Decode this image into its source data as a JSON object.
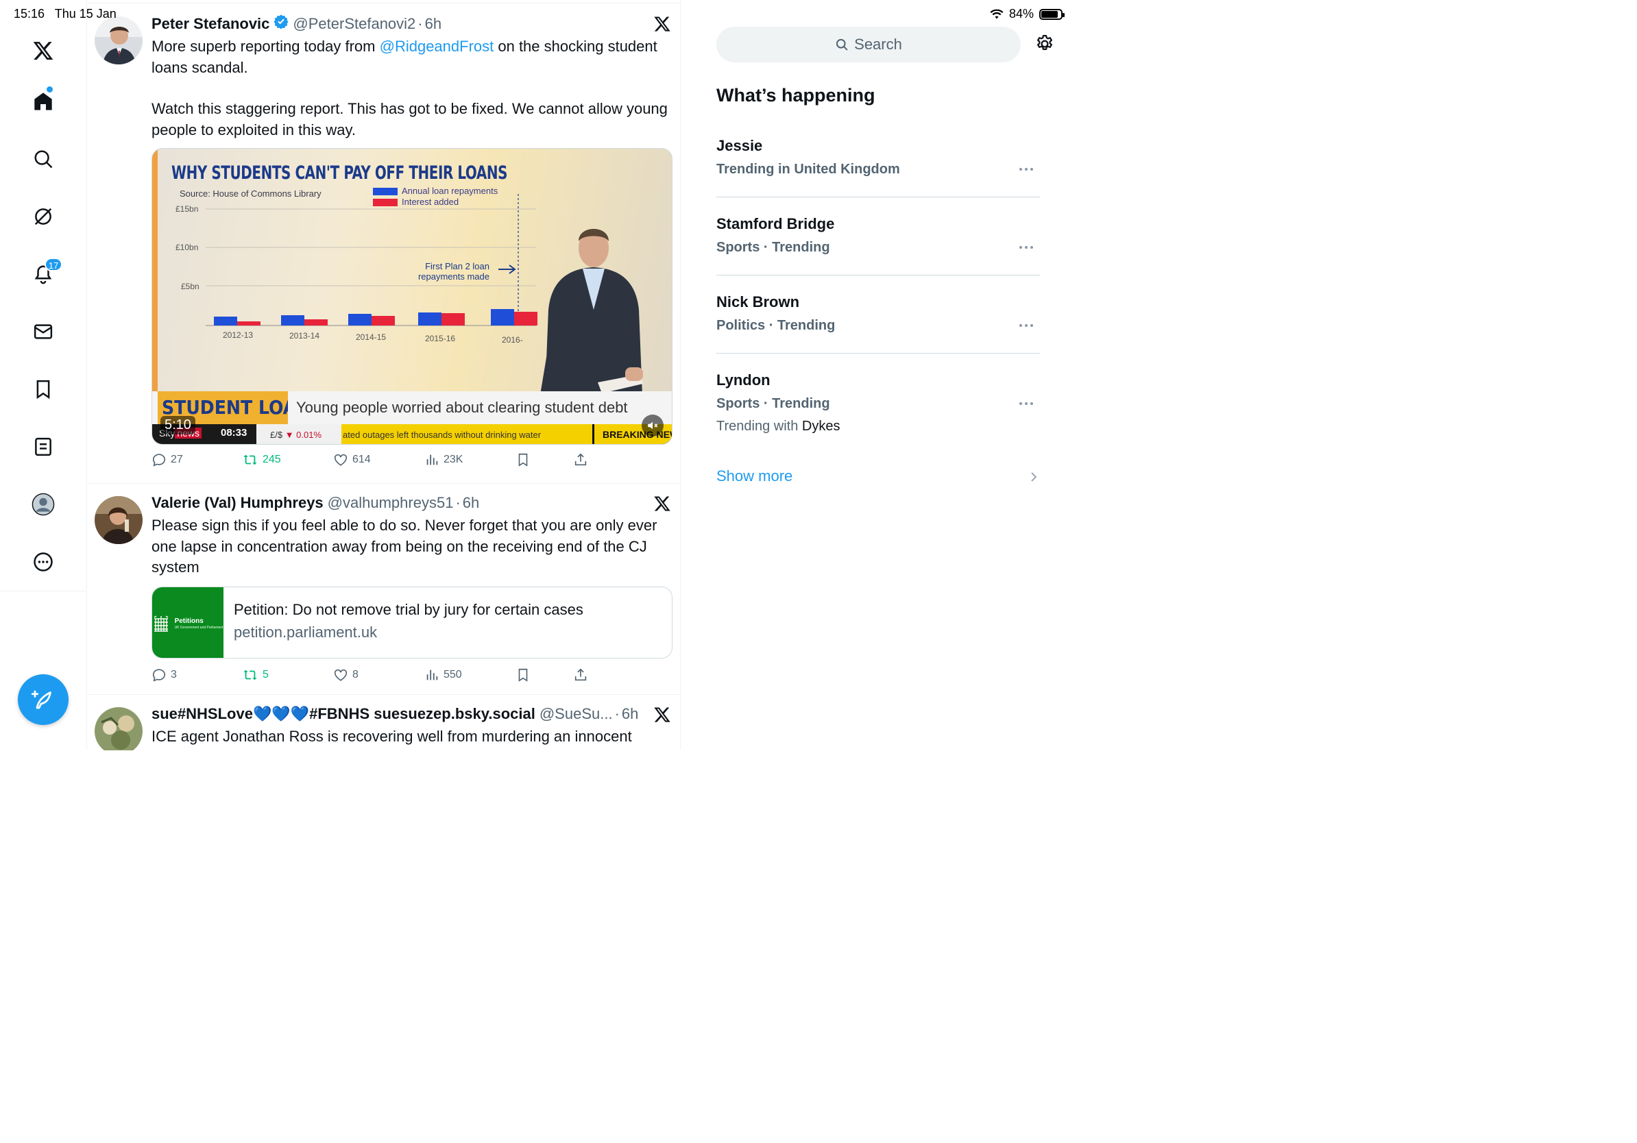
{
  "status_bar": {
    "time": "15:16",
    "date": "Thu 15 Jan",
    "battery": "84%",
    "battery_level": 0.84
  },
  "nav": {
    "items": [
      {
        "icon": "x-logo-icon"
      },
      {
        "icon": "home-icon",
        "has_dot": true
      },
      {
        "icon": "search-icon"
      },
      {
        "icon": "grok-icon"
      },
      {
        "icon": "bell-icon",
        "badge": "17"
      },
      {
        "icon": "mail-icon"
      },
      {
        "icon": "bookmark-icon"
      },
      {
        "icon": "lists-icon"
      },
      {
        "icon": "profile-icon"
      },
      {
        "icon": "more-icon"
      }
    ],
    "compose_icon": "compose-icon"
  },
  "tweets": [
    {
      "name": "Peter Stefanovic",
      "verified": true,
      "handle": "@PeterStefanovi2",
      "time": "6h",
      "text_before_link": "More superb reporting today from ",
      "link": "@RidgeandFrost",
      "text_after_link": " on the shocking student loans scandal.",
      "text_2": "Watch this staggering report. This has got to be fixed. We cannot allow young people to exploited in this way.",
      "video": {
        "title": "WHY STUDENTS CAN'T PAY OFF THEIR LOANS",
        "source": "Source: House of Commons Library",
        "legend": [
          "Annual loan repayments",
          "Interest added"
        ],
        "y_ticks": [
          "£15bn",
          "£10bn",
          "£5bn"
        ],
        "x_ticks": [
          "2012-13",
          "2013-14",
          "2014-15",
          "2015-16",
          "2016-"
        ],
        "annotation": "First Plan 2 loan repayments made",
        "lower_tag": "STUDENT LOANS",
        "lower_text": "Young people worried about clearing student debt",
        "channel_a": "Sky",
        "channel_b": "news",
        "clock": "08:33",
        "fx": "£/$",
        "fx_change": "▼ 0.01%",
        "ticker": "ated outages left thousands without drinking water",
        "breaking": "BREAKING NEWS",
        "duration": "5:10"
      },
      "stats": {
        "replies": "27",
        "reposts": "245",
        "likes": "614",
        "views": "23K"
      }
    },
    {
      "name": "Valerie (Val) Humphreys",
      "handle": "@valhumphreys51",
      "time": "6h",
      "text": "Please sign this if you feel able to do so. Never forget that you are only ever one lapse in concentration away from being on the receiving end of the CJ system",
      "card": {
        "thumb_title": "Petitions",
        "thumb_sub": "UK Government and Parliament",
        "title": "Petition: Do not remove trial by jury for certain cases",
        "domain": "petition.parliament.uk"
      },
      "stats": {
        "replies": "3",
        "reposts": "5",
        "likes": "8",
        "views": "550"
      }
    },
    {
      "name": "sue#NHSLove💙💙💙#FBNHS suesuezep.bsky.social",
      "handle": "@SueSu...",
      "time": "6h",
      "text": "ICE agent Jonathan Ross is recovering well from murdering an innocent"
    }
  ],
  "sidebar": {
    "search_placeholder": "Search",
    "section_title": "What’s happening",
    "trends": [
      {
        "name": "Jessie",
        "meta": "Trending in United Kingdom"
      },
      {
        "name": "Stamford Bridge",
        "meta": "Sports · Trending"
      },
      {
        "name": "Nick Brown",
        "meta": "Politics · Trending"
      },
      {
        "name": "Lyndon",
        "meta": "Sports · Trending",
        "extra_prefix": "Trending with ",
        "extra_name": "Dykes"
      }
    ],
    "show_more": "Show more"
  },
  "colors": {
    "accent": "#1d9bf0",
    "text": "#0f1419",
    "muted": "#536471",
    "repost": "#00ba7c",
    "border": "#eff3f4"
  }
}
